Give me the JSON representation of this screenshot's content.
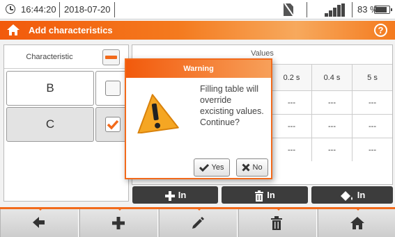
{
  "status": {
    "time": "16:44:20",
    "date": "2018-07-20",
    "battery": "83 %",
    "battery_level": 0.83,
    "icons": [
      "clock-icon",
      "sd-card-disabled-icon",
      "signal-bars-icon",
      "battery-icon"
    ]
  },
  "header": {
    "title": "Add characteristics",
    "help_symbol": "?"
  },
  "left_table": {
    "header": "Characteristic",
    "rows": [
      {
        "label": "B",
        "checked": false
      },
      {
        "label": "C",
        "checked": true
      }
    ]
  },
  "values_table": {
    "title": "Values",
    "columns": [
      "0.2 s",
      "0.4 s",
      "5 s"
    ],
    "cell_value": "---",
    "row_count": 3
  },
  "in_buttons": {
    "add": "In",
    "delete": "In",
    "fill": "In"
  },
  "dialog": {
    "title": "Warning",
    "message": "Filling table will override excisting values. Continue?",
    "message_lines": [
      "Filling table will",
      "override",
      "excisting values.",
      "Continue?"
    ],
    "yes": "Yes",
    "no": "No"
  },
  "toolbar": {
    "icons": [
      "back-arrow-icon",
      "plus-icon",
      "pencil-icon",
      "trash-icon",
      "home-icon"
    ]
  },
  "colors": {
    "accent": "#f26a1b",
    "button_dark": "#3c3c3c"
  }
}
